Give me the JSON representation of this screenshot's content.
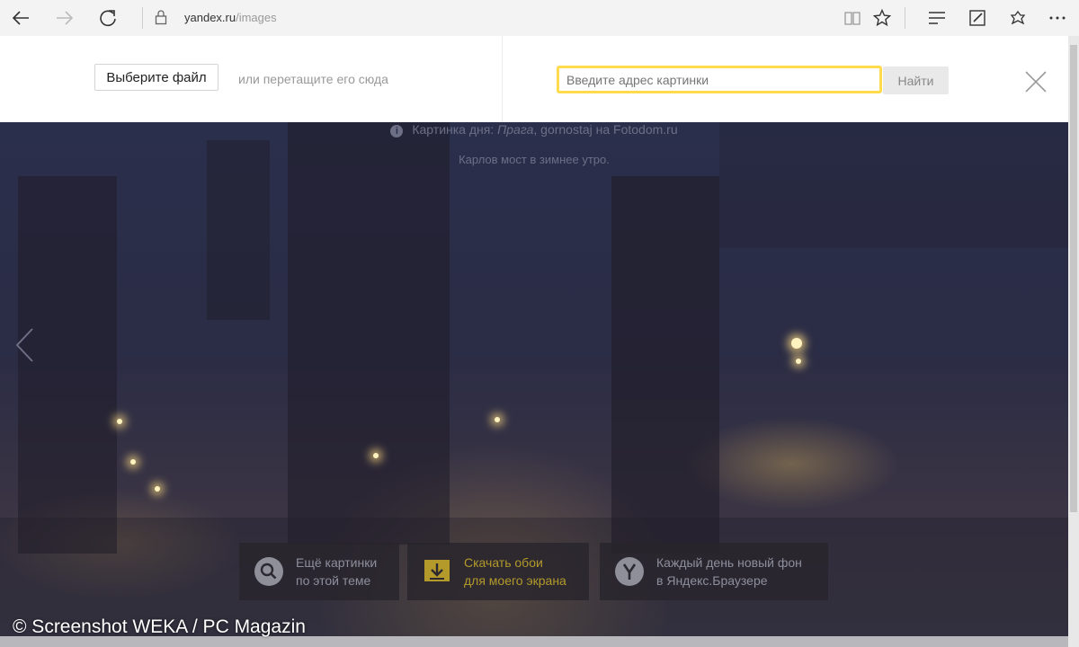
{
  "browser": {
    "url_host": "yandex.ru",
    "url_path": "/images",
    "icons": [
      "back-arrow-icon",
      "forward-arrow-icon",
      "refresh-icon",
      "lock-icon",
      "reading-view-icon",
      "favorite-star-icon",
      "hub-icon",
      "web-note-icon",
      "share-icon",
      "more-icon"
    ]
  },
  "upload_panel": {
    "choose_file_label": "Выберите файл",
    "drag_hint": "или перетащите его сюда",
    "url_placeholder": "Введите адрес картинки",
    "url_value": "",
    "find_label": "Найти"
  },
  "photo": {
    "caption_prefix": "Картинка дня: ",
    "caption_place": "Прага",
    "caption_suffix": ", gornostaj на Fotodom.ru",
    "caption_description": "Карлов мост в зимнее утро."
  },
  "actions": [
    {
      "line1": "Ещё картинки",
      "line2": "по этой теме",
      "icon": "search-icon"
    },
    {
      "line1": "Скачать обои",
      "line2": "для моего экрана",
      "icon": "download-icon"
    },
    {
      "line1": "Каждый день новый фон",
      "line2": "в Яндекс.Браузере",
      "icon": "yandex-browser-icon"
    }
  ],
  "watermark": "© Screenshot WEKA / PC Magazin",
  "colors": {
    "input_focus": "#ffdb4d",
    "accent_yellow": "#b39a2b"
  }
}
